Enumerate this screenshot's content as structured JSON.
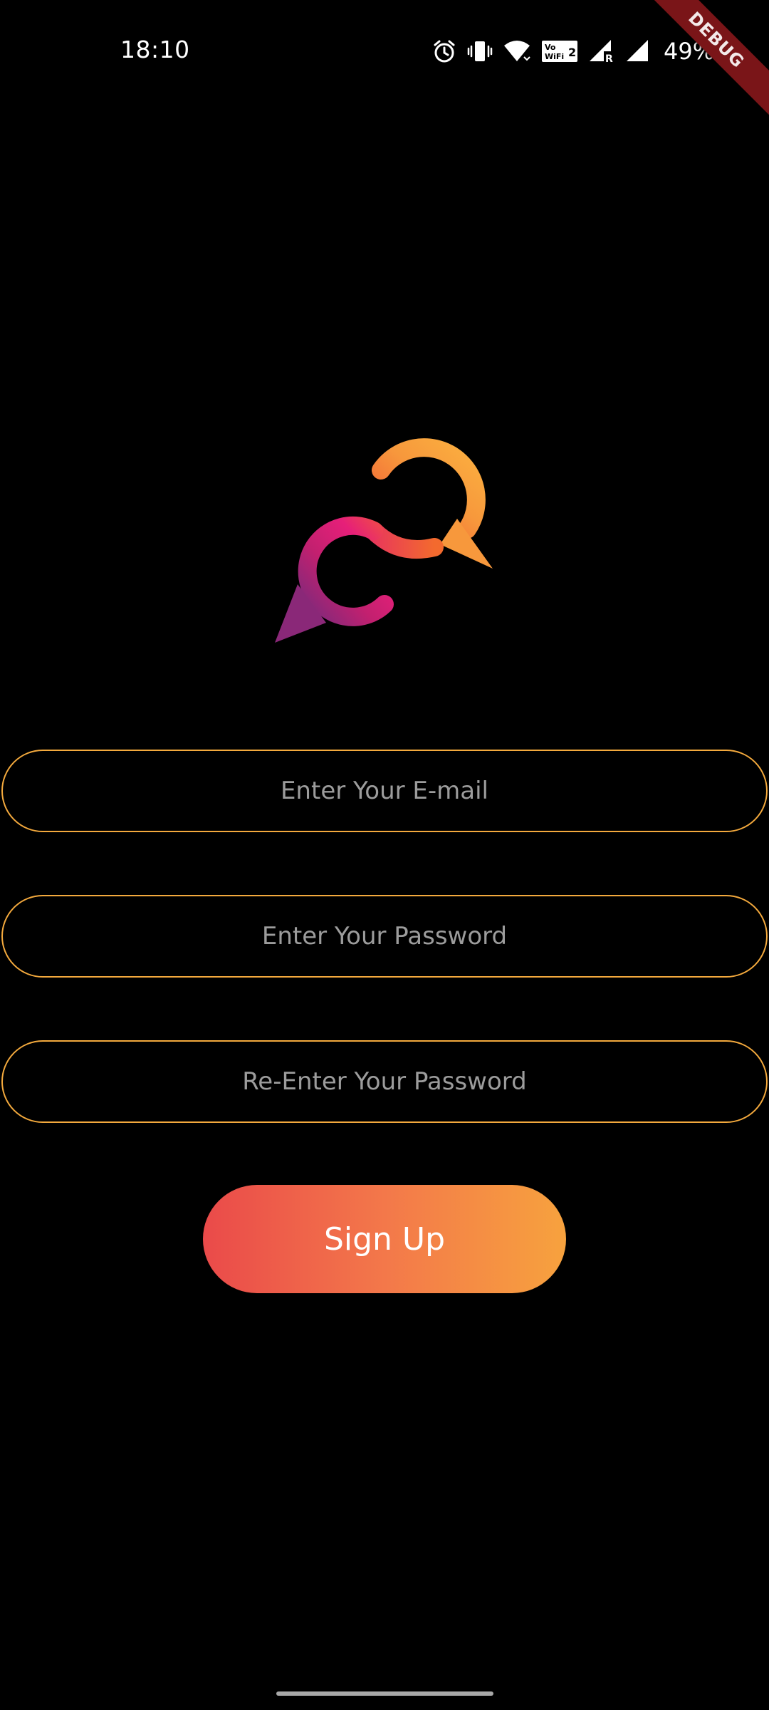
{
  "status_bar": {
    "time": "18:10",
    "battery": "49%",
    "icons": [
      "alarm-icon",
      "vibrate-icon",
      "wifi-icon",
      "vowifi-icon",
      "signal-icon",
      "signal-roaming-icon",
      "battery-charging-icon"
    ]
  },
  "debug_banner": "DEBUG",
  "logo": {
    "name": "chat-bubbles-logo",
    "colors": {
      "orange": "#f7a83e",
      "red_orange": "#f15a34",
      "pink": "#e61f79",
      "purple": "#7b2a7c"
    }
  },
  "form": {
    "email_placeholder": "Enter Your E-mail",
    "password_placeholder": "Enter Your Password",
    "repassword_placeholder": "Re-Enter Your Password",
    "email_value": "",
    "password_value": "",
    "repassword_value": ""
  },
  "signup_button": {
    "label": "Sign Up"
  },
  "theme": {
    "background": "#000000",
    "field_border": "#f3a93d",
    "button_gradient_start": "#ea4a4a",
    "button_gradient_end": "#f7a23e",
    "placeholder": "#9c9c9c"
  }
}
